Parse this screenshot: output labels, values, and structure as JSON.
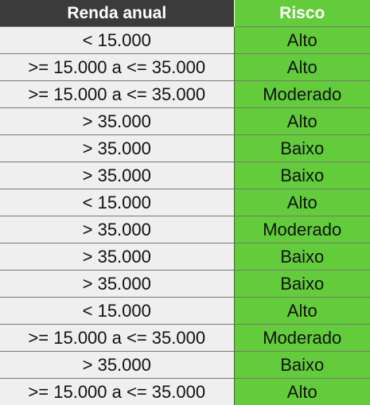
{
  "headers": [
    "Renda anual",
    "Risco"
  ],
  "rows": [
    [
      "< 15.000",
      "Alto"
    ],
    [
      ">= 15.000 a <= 35.000",
      "Alto"
    ],
    [
      ">= 15.000 a <= 35.000",
      "Moderado"
    ],
    [
      "> 35.000",
      "Alto"
    ],
    [
      "> 35.000",
      "Baixo"
    ],
    [
      "> 35.000",
      "Baixo"
    ],
    [
      "< 15.000",
      "Alto"
    ],
    [
      "> 35.000",
      "Moderado"
    ],
    [
      "> 35.000",
      "Baixo"
    ],
    [
      "> 35.000",
      "Baixo"
    ],
    [
      "< 15.000",
      "Alto"
    ],
    [
      ">= 15.000 a <= 35.000",
      "Moderado"
    ],
    [
      "> 35.000",
      "Baixo"
    ],
    [
      ">= 15.000 a <= 35.000",
      "Alto"
    ]
  ],
  "colors": {
    "header_dark": "#3b3b3b",
    "accent_green": "#63cc3a",
    "row_gray": "#efefef"
  }
}
